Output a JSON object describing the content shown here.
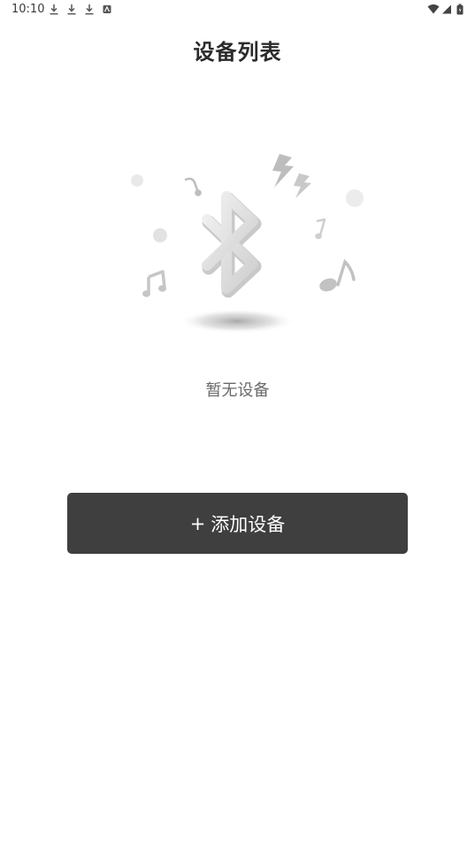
{
  "status_bar": {
    "time": "10:10",
    "icons": [
      "download-icon",
      "download-icon",
      "download-icon",
      "notification-icon",
      "wifi-icon",
      "signal-icon",
      "battery-icon"
    ]
  },
  "header": {
    "title": "设备列表"
  },
  "empty_state": {
    "message": "暂无设备",
    "illustration": "bluetooth-icon"
  },
  "actions": {
    "add_plus": "+",
    "add_label": "添加设备"
  },
  "colors": {
    "button_bg": "#3f3f3f",
    "title_text": "#2b2b2b",
    "muted_text": "#6a6a6a"
  }
}
